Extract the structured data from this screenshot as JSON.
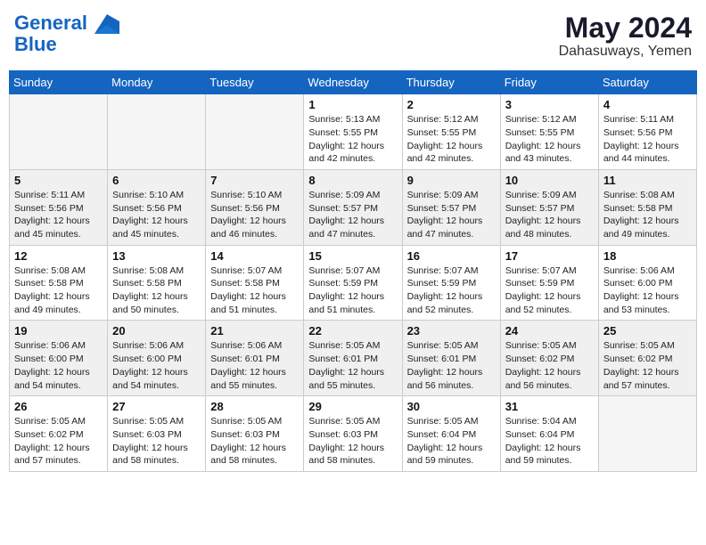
{
  "header": {
    "logo_line1": "General",
    "logo_line2": "Blue",
    "month_year": "May 2024",
    "location": "Dahasuways, Yemen"
  },
  "weekdays": [
    "Sunday",
    "Monday",
    "Tuesday",
    "Wednesday",
    "Thursday",
    "Friday",
    "Saturday"
  ],
  "weeks": [
    [
      {
        "day": "",
        "empty": true
      },
      {
        "day": "",
        "empty": true
      },
      {
        "day": "",
        "empty": true
      },
      {
        "day": "1",
        "sunrise": "5:13 AM",
        "sunset": "5:55 PM",
        "daylight": "12 hours and 42 minutes."
      },
      {
        "day": "2",
        "sunrise": "5:12 AM",
        "sunset": "5:55 PM",
        "daylight": "12 hours and 42 minutes."
      },
      {
        "day": "3",
        "sunrise": "5:12 AM",
        "sunset": "5:55 PM",
        "daylight": "12 hours and 43 minutes."
      },
      {
        "day": "4",
        "sunrise": "5:11 AM",
        "sunset": "5:56 PM",
        "daylight": "12 hours and 44 minutes."
      }
    ],
    [
      {
        "day": "5",
        "sunrise": "5:11 AM",
        "sunset": "5:56 PM",
        "daylight": "12 hours and 45 minutes."
      },
      {
        "day": "6",
        "sunrise": "5:10 AM",
        "sunset": "5:56 PM",
        "daylight": "12 hours and 45 minutes."
      },
      {
        "day": "7",
        "sunrise": "5:10 AM",
        "sunset": "5:56 PM",
        "daylight": "12 hours and 46 minutes."
      },
      {
        "day": "8",
        "sunrise": "5:09 AM",
        "sunset": "5:57 PM",
        "daylight": "12 hours and 47 minutes."
      },
      {
        "day": "9",
        "sunrise": "5:09 AM",
        "sunset": "5:57 PM",
        "daylight": "12 hours and 47 minutes."
      },
      {
        "day": "10",
        "sunrise": "5:09 AM",
        "sunset": "5:57 PM",
        "daylight": "12 hours and 48 minutes."
      },
      {
        "day": "11",
        "sunrise": "5:08 AM",
        "sunset": "5:58 PM",
        "daylight": "12 hours and 49 minutes."
      }
    ],
    [
      {
        "day": "12",
        "sunrise": "5:08 AM",
        "sunset": "5:58 PM",
        "daylight": "12 hours and 49 minutes."
      },
      {
        "day": "13",
        "sunrise": "5:08 AM",
        "sunset": "5:58 PM",
        "daylight": "12 hours and 50 minutes."
      },
      {
        "day": "14",
        "sunrise": "5:07 AM",
        "sunset": "5:58 PM",
        "daylight": "12 hours and 51 minutes."
      },
      {
        "day": "15",
        "sunrise": "5:07 AM",
        "sunset": "5:59 PM",
        "daylight": "12 hours and 51 minutes."
      },
      {
        "day": "16",
        "sunrise": "5:07 AM",
        "sunset": "5:59 PM",
        "daylight": "12 hours and 52 minutes."
      },
      {
        "day": "17",
        "sunrise": "5:07 AM",
        "sunset": "5:59 PM",
        "daylight": "12 hours and 52 minutes."
      },
      {
        "day": "18",
        "sunrise": "5:06 AM",
        "sunset": "6:00 PM",
        "daylight": "12 hours and 53 minutes."
      }
    ],
    [
      {
        "day": "19",
        "sunrise": "5:06 AM",
        "sunset": "6:00 PM",
        "daylight": "12 hours and 54 minutes."
      },
      {
        "day": "20",
        "sunrise": "5:06 AM",
        "sunset": "6:00 PM",
        "daylight": "12 hours and 54 minutes."
      },
      {
        "day": "21",
        "sunrise": "5:06 AM",
        "sunset": "6:01 PM",
        "daylight": "12 hours and 55 minutes."
      },
      {
        "day": "22",
        "sunrise": "5:05 AM",
        "sunset": "6:01 PM",
        "daylight": "12 hours and 55 minutes."
      },
      {
        "day": "23",
        "sunrise": "5:05 AM",
        "sunset": "6:01 PM",
        "daylight": "12 hours and 56 minutes."
      },
      {
        "day": "24",
        "sunrise": "5:05 AM",
        "sunset": "6:02 PM",
        "daylight": "12 hours and 56 minutes."
      },
      {
        "day": "25",
        "sunrise": "5:05 AM",
        "sunset": "6:02 PM",
        "daylight": "12 hours and 57 minutes."
      }
    ],
    [
      {
        "day": "26",
        "sunrise": "5:05 AM",
        "sunset": "6:02 PM",
        "daylight": "12 hours and 57 minutes."
      },
      {
        "day": "27",
        "sunrise": "5:05 AM",
        "sunset": "6:03 PM",
        "daylight": "12 hours and 58 minutes."
      },
      {
        "day": "28",
        "sunrise": "5:05 AM",
        "sunset": "6:03 PM",
        "daylight": "12 hours and 58 minutes."
      },
      {
        "day": "29",
        "sunrise": "5:05 AM",
        "sunset": "6:03 PM",
        "daylight": "12 hours and 58 minutes."
      },
      {
        "day": "30",
        "sunrise": "5:05 AM",
        "sunset": "6:04 PM",
        "daylight": "12 hours and 59 minutes."
      },
      {
        "day": "31",
        "sunrise": "5:04 AM",
        "sunset": "6:04 PM",
        "daylight": "12 hours and 59 minutes."
      },
      {
        "day": "",
        "empty": true
      }
    ]
  ],
  "labels": {
    "sunrise": "Sunrise:",
    "sunset": "Sunset:",
    "daylight": "Daylight:"
  }
}
